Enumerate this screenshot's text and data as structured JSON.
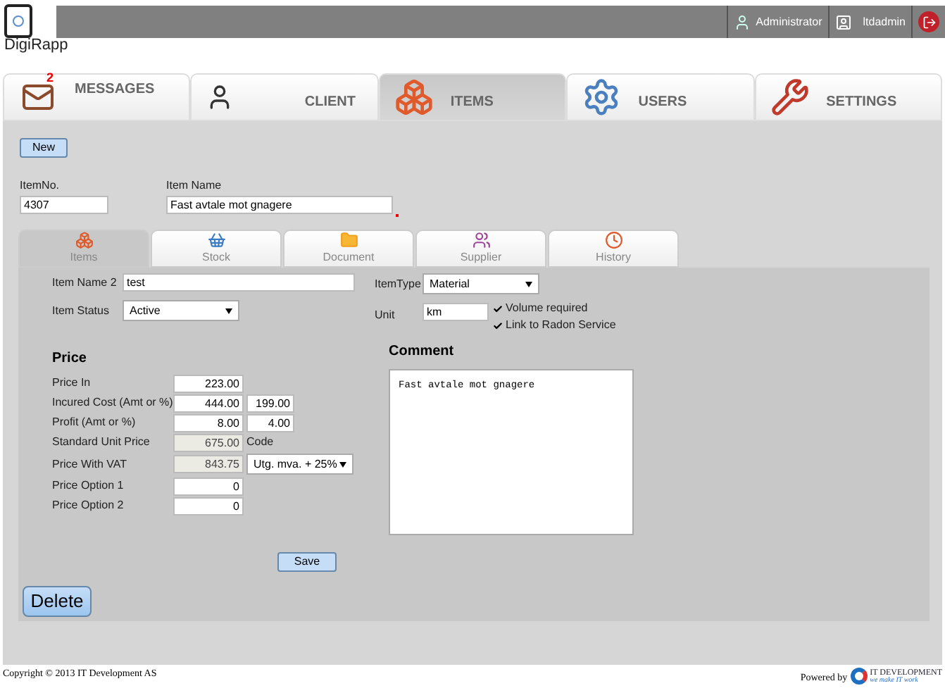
{
  "logo": "DigiRapp",
  "header": {
    "user_role": "Administrator",
    "username": "ltdadmin"
  },
  "nav_tabs": [
    {
      "label": "MESSAGES",
      "selected": false,
      "badge": "2"
    },
    {
      "label": "CLIENT",
      "selected": false
    },
    {
      "label": "ITEMS",
      "selected": true
    },
    {
      "label": "USERS",
      "selected": false
    },
    {
      "label": "SETTINGS",
      "selected": false
    }
  ],
  "new_button": "New",
  "item_no": {
    "label": "ItemNo.",
    "value": "4307"
  },
  "item_name": {
    "label": "Item Name",
    "value": "Fast avtale mot gnagere",
    "required": true
  },
  "sub_tabs": [
    {
      "label": "Items",
      "selected": true
    },
    {
      "label": "Stock",
      "selected": false
    },
    {
      "label": "Document",
      "selected": false
    },
    {
      "label": "Supplier",
      "selected": false
    },
    {
      "label": "History",
      "selected": false
    }
  ],
  "item_name_2": {
    "label": "Item Name 2",
    "value": "test"
  },
  "item_status": {
    "label": "Item Status",
    "value": "Active"
  },
  "item_type": {
    "label": "ItemType",
    "value": "Material"
  },
  "unit": {
    "label": "Unit",
    "value": "km"
  },
  "checkboxes": [
    {
      "label": "Volume required",
      "checked": true
    },
    {
      "label": "Link to Radon Service",
      "checked": true
    }
  ],
  "price": {
    "heading": "Price",
    "rows": [
      {
        "kind": "single",
        "label": "Price In",
        "value": "223.00"
      },
      {
        "kind": "double",
        "label": "Incured Cost (Amt or %)",
        "value": "444.00",
        "value_2": "199.00"
      },
      {
        "kind": "double",
        "label": "Profit (Amt or %)",
        "value": "8.00",
        "value_2": "4.00"
      },
      {
        "kind": "readonly_note",
        "label": "Standard Unit Price",
        "value": "675.00",
        "note": "Code"
      },
      {
        "kind": "readonly_select",
        "label": "Price With VAT",
        "value": "843.75",
        "option": "Utg. mva. + 25%"
      },
      {
        "kind": "single",
        "label": "Price Option 1",
        "value": "0"
      },
      {
        "kind": "single",
        "label": "Price Option 2",
        "value": "0"
      }
    ]
  },
  "comment": {
    "heading": "Comment",
    "value": "Fast avtale mot gnagere"
  },
  "save_button": "Save",
  "delete_button": "Delete",
  "footer": {
    "copyright": "Copyright © 2013 IT Development AS",
    "powered_by": "Powered by",
    "brand": "IT DEVELOPMENT",
    "tagline": "we make IT work"
  }
}
